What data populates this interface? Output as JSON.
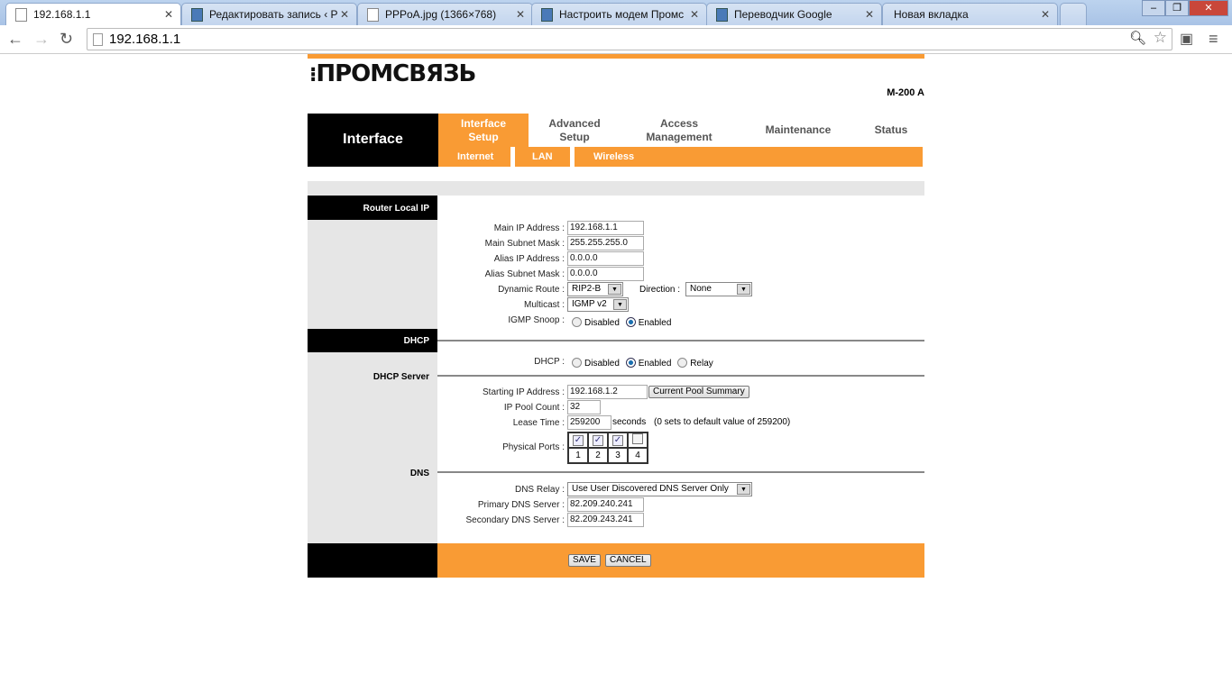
{
  "browser": {
    "tabs": [
      {
        "title": "192.168.1.1",
        "active": true,
        "icon": "page-icon"
      },
      {
        "title": "Редактировать запись ‹ Р",
        "icon": "monitor-icon"
      },
      {
        "title": "PPPoA.jpg (1366×768)",
        "icon": "page-icon"
      },
      {
        "title": "Настроить модем Промс",
        "icon": "monitor-icon"
      },
      {
        "title": "Переводчик Google",
        "icon": "translate-icon"
      },
      {
        "title": "Новая вкладка",
        "icon": "none"
      }
    ],
    "url": "192.168.1.1"
  },
  "header": {
    "logo": "ПРОМСВЯЗЬ",
    "model": "M-200 A"
  },
  "nav": {
    "section": "Interface",
    "tabs": [
      {
        "label": "Interface Setup",
        "active": true
      },
      {
        "label": "Advanced Setup"
      },
      {
        "label": "Access Management"
      },
      {
        "label": "Maintenance"
      },
      {
        "label": "Status"
      }
    ],
    "subtabs": [
      "Internet",
      "LAN",
      "Wireless"
    ]
  },
  "router_local_ip": {
    "heading": "Router Local IP",
    "main_ip_label": "Main IP Address :",
    "main_ip": "192.168.1.1",
    "main_mask_label": "Main Subnet Mask :",
    "main_mask": "255.255.255.0",
    "alias_ip_label": "Alias IP Address :",
    "alias_ip": "0.0.0.0",
    "alias_mask_label": "Alias Subnet Mask :",
    "alias_mask": "0.0.0.0",
    "dynamic_route_label": "Dynamic Route :",
    "dynamic_route": "RIP2-B",
    "direction_label": "Direction :",
    "direction": "None",
    "multicast_label": "Multicast :",
    "multicast": "IGMP v2",
    "igmp_snoop_label": "IGMP Snoop :",
    "igmp_options": [
      "Disabled",
      "Enabled"
    ],
    "igmp_selected": "Enabled"
  },
  "dhcp": {
    "heading": "DHCP",
    "server_heading": "DHCP Server",
    "dhcp_label": "DHCP :",
    "options": [
      "Disabled",
      "Enabled",
      "Relay"
    ],
    "selected": "Enabled",
    "start_ip_label": "Starting IP Address :",
    "start_ip": "192.168.1.2",
    "pool_summary_button": "Current Pool Summary",
    "pool_count_label": "IP Pool Count :",
    "pool_count": "32",
    "lease_label": "Lease Time :",
    "lease": "259200",
    "lease_unit": "seconds",
    "lease_note": "(0 sets to default value of 259200)",
    "ports_label": "Physical Ports :",
    "ports": [
      {
        "n": "1",
        "checked": true
      },
      {
        "n": "2",
        "checked": true
      },
      {
        "n": "3",
        "checked": true
      },
      {
        "n": "4",
        "checked": false
      }
    ]
  },
  "dns": {
    "heading": "DNS",
    "relay_label": "DNS Relay :",
    "relay": "Use User Discovered DNS Server Only",
    "primary_label": "Primary DNS Server :",
    "primary": "82.209.240.241",
    "secondary_label": "Secondary DNS Server :",
    "secondary": "82.209.243.241"
  },
  "footer": {
    "save": "SAVE",
    "cancel": "CANCEL"
  },
  "colors": {
    "accent": "#f99b34",
    "dark": "#000000",
    "panel": "#e6e6e6"
  }
}
